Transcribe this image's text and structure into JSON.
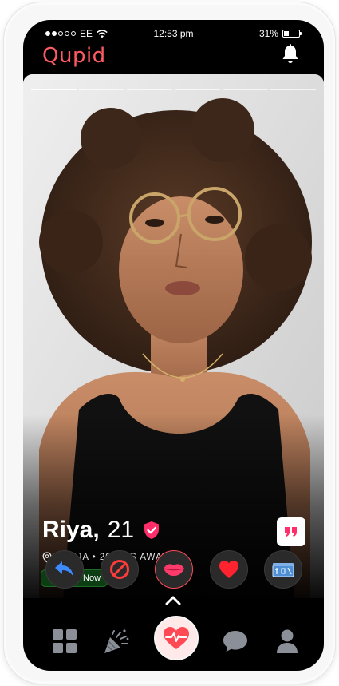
{
  "status_bar": {
    "carrier": "EE",
    "time": "12:53 pm",
    "battery": "31%",
    "battery_level": 0.31
  },
  "header": {
    "app_name": "Qupid",
    "notification_icon": "bell-icon"
  },
  "profile": {
    "name": "Riya,",
    "age": "21",
    "location": "ABUJA • 20 KMS AWAY",
    "status": "Active Now",
    "photo_count": 6,
    "photo_index": 1
  },
  "actions": [
    {
      "name": "undo-button",
      "icon": "undo-icon"
    },
    {
      "name": "block-button",
      "icon": "block-icon"
    },
    {
      "name": "kiss-button",
      "icon": "lips-icon"
    },
    {
      "name": "like-button",
      "icon": "heart-icon"
    },
    {
      "name": "gift-button",
      "icon": "gift-icon"
    }
  ],
  "bottom_nav": [
    {
      "name": "nav-discover",
      "icon": "grid-icon"
    },
    {
      "name": "nav-party",
      "icon": "party-popper-icon"
    },
    {
      "name": "nav-match",
      "icon": "heartbeat-icon"
    },
    {
      "name": "nav-messages",
      "icon": "chat-icon"
    },
    {
      "name": "nav-profile",
      "icon": "user-icon"
    }
  ],
  "colors": {
    "brand": "#ff5a63",
    "verified": "#ff2d6a",
    "active_green": "#3ee05a",
    "nav_icon": "#8a8f98"
  }
}
